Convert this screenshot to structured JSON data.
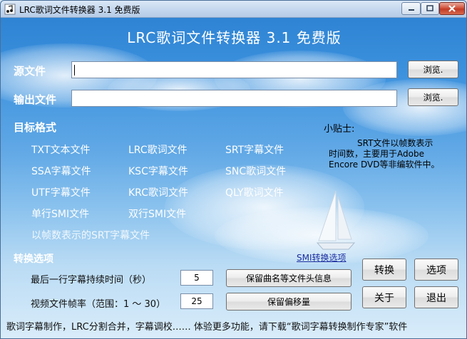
{
  "window": {
    "title": "LRC歌词文件转换器 3.1 免费版",
    "heading": "LRC歌词文件转换器 3.1 免费版"
  },
  "source": {
    "label": "源文件",
    "value": "",
    "browse_label": "浏览."
  },
  "output": {
    "label": "输出文件",
    "value": "",
    "browse_label": "浏览."
  },
  "target_format": {
    "label": "目标格式",
    "items": [
      "TXT文本文件",
      "LRC歌词文件",
      "SRT字幕文件",
      "SSA字幕文件",
      "KSC字幕文件",
      "SNC歌词文件",
      "UTF字幕文件",
      "KRC歌词文件",
      "QLY歌词文件",
      "单行SMI文件",
      "双行SMI文件",
      "以帧数表示的SRT字幕文件"
    ]
  },
  "tip": {
    "title": "小贴士:",
    "lines": [
      "SRT文件以帧数表示",
      "时间数，主要用于Adobe",
      "Encore DVD等非编软件中。"
    ]
  },
  "options": {
    "label": "转换选项",
    "smi_link": "SMI转换选项",
    "last_line_label": "最后一行字幕持续时间（秒）",
    "last_line_value": "5",
    "framerate_label": "视频文件帧率（范围：1 ～ 30）",
    "framerate_value": "25",
    "keep_header_label": "保留曲名等文件头信息",
    "keep_offset_label": "保留偏移量"
  },
  "actions": {
    "convert": "转换",
    "options": "选项",
    "about": "关于",
    "exit": "退出"
  },
  "footer": "歌词字幕制作，LRC分割合并，字幕调校……  体验更多功能，请下载“歌词字幕转换制作专家”软件",
  "colors": {
    "title_close": "#c13b25",
    "accent": "#2a7fd0",
    "link": "#1c2ea0"
  }
}
